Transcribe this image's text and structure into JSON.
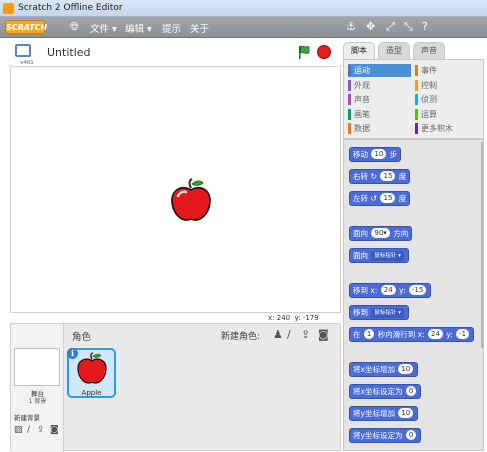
{
  "window": {
    "title": "Scratch 2 Offline Editor"
  },
  "menubar": {
    "logo_text": "SCRATCH",
    "items": [
      "文件 ▾",
      "编辑 ▾",
      "提示",
      "关于"
    ],
    "icons": [
      "globe-icon",
      "stamp-icon",
      "expand-icon",
      "shrink-icon",
      "help-icon"
    ]
  },
  "stage": {
    "version": "v461",
    "project_title": "Untitled",
    "x_label": "x:",
    "x_value": "240",
    "y_label": "y:",
    "y_value": "-179"
  },
  "sprites_panel": {
    "label": "角色",
    "new_sprite_label": "新建角色:",
    "stage_label": "舞台",
    "backdrop_count": "1 背景",
    "new_backdrop_label": "新建背景",
    "sprites": [
      {
        "name": "Apple"
      }
    ]
  },
  "tabs": [
    "脚本",
    "造型",
    "声音"
  ],
  "categories": [
    {
      "label": "运动",
      "color": "#4a6cd4",
      "active": true
    },
    {
      "label": "事件",
      "color": "#c88330"
    },
    {
      "label": "外观",
      "color": "#8a55d7"
    },
    {
      "label": "控制",
      "color": "#e1a91a"
    },
    {
      "label": "声音",
      "color": "#bb42c3"
    },
    {
      "label": "侦测",
      "color": "#2ca5e2"
    },
    {
      "label": "画笔",
      "color": "#0e9a6c"
    },
    {
      "label": "运算",
      "color": "#5cb712"
    },
    {
      "label": "数据",
      "color": "#ee7d16"
    },
    {
      "label": "更多积木",
      "color": "#632d99"
    }
  ],
  "blocks": {
    "move": {
      "label": "移动",
      "value": "10",
      "suffix": "步"
    },
    "turn_right": {
      "label": "右转",
      "value": "15",
      "suffix": "度"
    },
    "turn_left": {
      "label": "左转",
      "value": "15",
      "suffix": "度"
    },
    "point_dir": {
      "label": "面向",
      "value": "90▾",
      "suffix": "方向"
    },
    "point_towards": {
      "label": "面向",
      "dropdown": "鼠标指针 ▾"
    },
    "go_to_xy": {
      "label": "移到 x:",
      "x": "24",
      "y_label": "y:",
      "y": "-15"
    },
    "go_to": {
      "label": "移到",
      "dropdown": "鼠标指针 ▾"
    },
    "glide": {
      "label": "在",
      "secs": "1",
      "mid": "秒内滑行到 x:",
      "x": "24",
      "y_label": "y:",
      "y": "-1"
    },
    "change_x": {
      "label": "将x坐标增加",
      "value": "10"
    },
    "set_x": {
      "label": "将x坐标设定为",
      "value": "0"
    },
    "change_y": {
      "label": "将y坐标增加",
      "value": "10"
    },
    "set_y": {
      "label": "将y坐标设定为",
      "value": "0"
    }
  }
}
